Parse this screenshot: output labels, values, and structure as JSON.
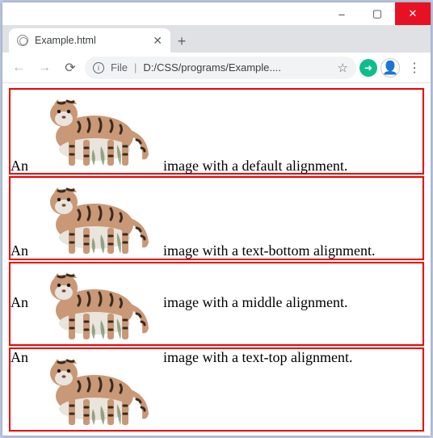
{
  "window": {
    "minimize": "–",
    "maximize": "▢",
    "close": "✕"
  },
  "tab": {
    "title": "Example.html",
    "close": "✕",
    "new": "+"
  },
  "toolbar": {
    "back": "←",
    "forward": "→",
    "reload": "⟳",
    "info": "i",
    "file_label": "File",
    "sep": "|",
    "url": "D:/CSS/programs/Example....",
    "star": "☆",
    "ext": "➜",
    "avatar": "👤",
    "menu": "⋮"
  },
  "rows": [
    {
      "prefix": "An",
      "suffix": "image with a default alignment."
    },
    {
      "prefix": "An",
      "suffix": "image with a text-bottom alignment."
    },
    {
      "prefix": "An",
      "suffix": "image with a middle alignment."
    },
    {
      "prefix": "An",
      "suffix": "image with a text-top alignment."
    }
  ],
  "tiger_colors": {
    "body": "#c99877",
    "stripe": "#3a2a1e",
    "white": "#e9e4dc"
  }
}
